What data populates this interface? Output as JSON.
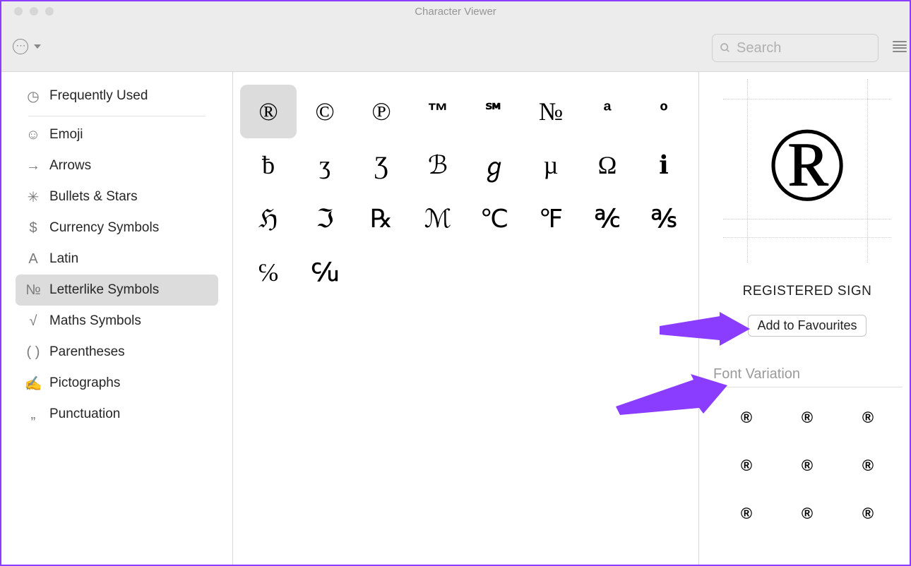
{
  "window": {
    "title": "Character Viewer"
  },
  "search": {
    "placeholder": "Search"
  },
  "sidebar": {
    "items": [
      {
        "icon": "clock",
        "glyph": "◷",
        "label": "Frequently Used"
      },
      {
        "icon": "emoji",
        "glyph": "☺",
        "label": "Emoji"
      },
      {
        "icon": "arrows",
        "glyph": "→",
        "label": "Arrows"
      },
      {
        "icon": "bullets",
        "glyph": "✳",
        "label": "Bullets & Stars"
      },
      {
        "icon": "currency",
        "glyph": "$",
        "label": "Currency Symbols"
      },
      {
        "icon": "latin",
        "glyph": "A",
        "label": "Latin"
      },
      {
        "icon": "numero",
        "glyph": "№",
        "label": "Letterlike Symbols"
      },
      {
        "icon": "sqrt",
        "glyph": "√",
        "label": "Maths Symbols"
      },
      {
        "icon": "parens",
        "glyph": "( )",
        "label": "Parentheses"
      },
      {
        "icon": "picto",
        "glyph": "✍",
        "label": "Pictographs"
      },
      {
        "icon": "punct",
        "glyph": "„",
        "label": "Punctuation"
      }
    ],
    "selected_index": 6
  },
  "grid": {
    "selected_index": 0,
    "chars": [
      "®",
      "©",
      "℗",
      "™",
      "℠",
      "№",
      "ª",
      "º",
      "ƀ",
      "ʒ",
      "Ʒ",
      "ℬ",
      "ℊ",
      "µ",
      "Ω",
      "ℹ",
      "ℌ",
      "ℑ",
      "℞",
      "ℳ",
      "℃",
      "℉",
      "℀",
      "℁",
      "℅",
      "℆"
    ]
  },
  "detail": {
    "glyph": "®",
    "name": "REGISTERED SIGN",
    "fav_button": "Add to Favourites",
    "section_title": "Font Variation",
    "variations": [
      "®",
      "®",
      "®",
      "®",
      "®",
      "®",
      "®",
      "®",
      "®"
    ]
  }
}
